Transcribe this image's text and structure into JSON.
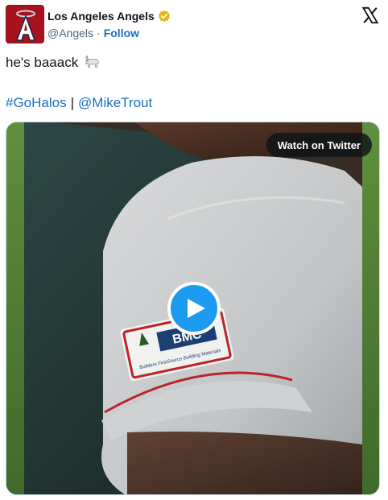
{
  "account": {
    "name": "Los Angeles Angels",
    "handle": "@Angels",
    "separator": "·",
    "follow_label": "Follow",
    "verified_color": "#e2b719"
  },
  "post": {
    "line1_text": "he's baaack",
    "line1_emoji": "goat-emoji",
    "hashtag": "#GoHalos",
    "divider": "|",
    "mention": "@MikeTrout"
  },
  "media": {
    "watch_label": "Watch on Twitter",
    "play_icon": "play-icon",
    "patch_text": "BMC",
    "patch_subtext": "Builders FirstSource Building Materials"
  },
  "colors": {
    "link": "#1d6ec2",
    "brand_red": "#a8121f",
    "play_blue": "#1d9bf0"
  }
}
